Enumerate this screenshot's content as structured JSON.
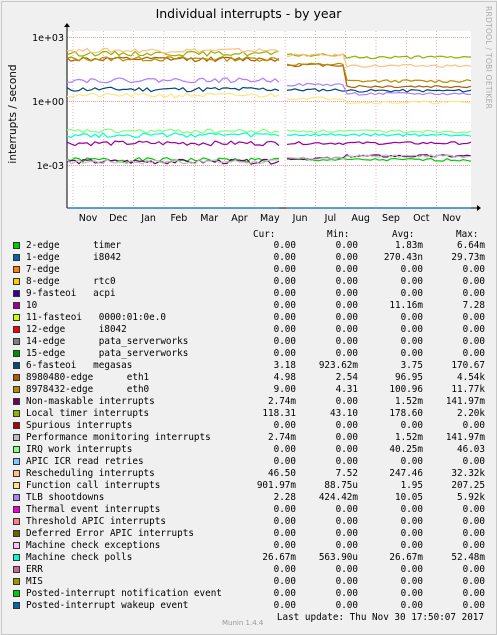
{
  "title": "Individual interrupts - by year",
  "side_text": "RRDTOOL / TOBI OETIKER",
  "munin_version": "Munin 1.4.4",
  "last_update": "Last update:  Thu Nov 30 17:50:07 2017",
  "legend_headers": {
    "cur": "Cur:",
    "min": "Min:",
    "avg": "Avg:",
    "max": "Max:"
  },
  "chart_data": {
    "type": "line",
    "title": "Individual interrupts - by year",
    "ylabel": "interrupts / second",
    "yscale": "log",
    "ylim": [
      1e-05,
      2000
    ],
    "y_ticks": [
      "1e+03",
      "1e+00",
      "1e-03"
    ],
    "x_ticks": [
      "Nov",
      "Dec",
      "Jan",
      "Feb",
      "Mar",
      "Apr",
      "May",
      "Jun",
      "Jul",
      "Aug",
      "Sep",
      "Oct",
      "Nov"
    ],
    "grid": true,
    "series": [
      {
        "name": "2-edge      timer",
        "color": "#00cc00",
        "cur": "0.00",
        "min": "0.00",
        "avg": "1.83m",
        "max": "6.64m"
      },
      {
        "name": "1-edge      i8042",
        "color": "#0066b3",
        "cur": "0.00",
        "min": "0.00",
        "avg": "270.43n",
        "max": "29.73m"
      },
      {
        "name": "7-edge",
        "color": "#ff8000",
        "cur": "0.00",
        "min": "0.00",
        "avg": "0.00",
        "max": "0.00"
      },
      {
        "name": "8-edge      rtc0",
        "color": "#ffcc00",
        "cur": "0.00",
        "min": "0.00",
        "avg": "0.00",
        "max": "0.00"
      },
      {
        "name": "9-fasteoi   acpi",
        "color": "#330099",
        "cur": "0.00",
        "min": "0.00",
        "avg": "0.00",
        "max": "0.00"
      },
      {
        "name": "10",
        "color": "#990099",
        "cur": "0.00",
        "min": "0.00",
        "avg": "11.16m",
        "max": "7.28"
      },
      {
        "name": "11-fasteoi   0000:01:0e.0",
        "color": "#ccff00",
        "cur": "0.00",
        "min": "0.00",
        "avg": "0.00",
        "max": "0.00"
      },
      {
        "name": "12-edge      i8042",
        "color": "#ff0000",
        "cur": "0.00",
        "min": "0.00",
        "avg": "0.00",
        "max": "0.00"
      },
      {
        "name": "14-edge      pata_serverworks",
        "color": "#808080",
        "cur": "0.00",
        "min": "0.00",
        "avg": "0.00",
        "max": "0.00"
      },
      {
        "name": "15-edge      pata_serverworks",
        "color": "#008f00",
        "cur": "0.00",
        "min": "0.00",
        "avg": "0.00",
        "max": "0.00"
      },
      {
        "name": "6-fasteoi   megasas",
        "color": "#00487d",
        "cur": "3.18",
        "min": "923.62m",
        "avg": "3.75",
        "max": "170.67"
      },
      {
        "name": "8980480-edge      eth1",
        "color": "#b35a00",
        "cur": "4.98",
        "min": "2.54",
        "avg": "96.95",
        "max": "4.54k"
      },
      {
        "name": "8978432-edge      eth0",
        "color": "#b38f00",
        "cur": "9.00",
        "min": "4.31",
        "avg": "100.96",
        "max": "11.77k"
      },
      {
        "name": "Non-maskable interrupts",
        "color": "#6b006b",
        "cur": "2.74m",
        "min": "0.00",
        "avg": "1.52m",
        "max": "141.97m"
      },
      {
        "name": "Local timer interrupts",
        "color": "#8fb300",
        "cur": "118.31",
        "min": "43.10",
        "avg": "178.60",
        "max": "2.20k"
      },
      {
        "name": "Spurious interrupts",
        "color": "#b30000",
        "cur": "0.00",
        "min": "0.00",
        "avg": "0.00",
        "max": "0.00"
      },
      {
        "name": "Performance monitoring interrupts",
        "color": "#bebebe",
        "cur": "2.74m",
        "min": "0.00",
        "avg": "1.52m",
        "max": "141.97m"
      },
      {
        "name": "IRQ work interrupts",
        "color": "#80ff80",
        "cur": "0.00",
        "min": "0.00",
        "avg": "40.25m",
        "max": "46.03"
      },
      {
        "name": "APIC ICR read retries",
        "color": "#80c9ff",
        "cur": "0.00",
        "min": "0.00",
        "avg": "0.00",
        "max": "0.00"
      },
      {
        "name": "Rescheduling interrupts",
        "color": "#ffc080",
        "cur": "46.50",
        "min": "7.52",
        "avg": "247.46",
        "max": "32.32k"
      },
      {
        "name": "Function call interrupts",
        "color": "#ffe680",
        "cur": "901.97m",
        "min": "88.75u",
        "avg": "1.95",
        "max": "207.25"
      },
      {
        "name": "TLB shootdowns",
        "color": "#aa80ff",
        "cur": "2.28",
        "min": "424.42m",
        "avg": "10.05",
        "max": "5.92k"
      },
      {
        "name": "Thermal event interrupts",
        "color": "#ee00cc",
        "cur": "0.00",
        "min": "0.00",
        "avg": "0.00",
        "max": "0.00"
      },
      {
        "name": "Threshold APIC interrupts",
        "color": "#ff8080",
        "cur": "0.00",
        "min": "0.00",
        "avg": "0.00",
        "max": "0.00"
      },
      {
        "name": "Deferred Error APIC interrupts",
        "color": "#666600",
        "cur": "0.00",
        "min": "0.00",
        "avg": "0.00",
        "max": "0.00"
      },
      {
        "name": "Machine check exceptions",
        "color": "#ffbfff",
        "cur": "0.00",
        "min": "0.00",
        "avg": "0.00",
        "max": "0.00"
      },
      {
        "name": "Machine check polls",
        "color": "#00ffcc",
        "cur": "26.67m",
        "min": "563.90u",
        "avg": "26.67m",
        "max": "52.48m"
      },
      {
        "name": "ERR",
        "color": "#cc6699",
        "cur": "0.00",
        "min": "0.00",
        "avg": "0.00",
        "max": "0.00"
      },
      {
        "name": "MIS",
        "color": "#999900",
        "cur": "0.00",
        "min": "0.00",
        "avg": "0.00",
        "max": "0.00"
      },
      {
        "name": "Posted-interrupt notification event",
        "color": "#00cc00",
        "cur": "0.00",
        "min": "0.00",
        "avg": "0.00",
        "max": "0.00"
      },
      {
        "name": "Posted-interrupt wakeup event",
        "color": "#0066b3",
        "cur": "0.00",
        "min": "0.00",
        "avg": "0.00",
        "max": "0.00"
      }
    ]
  }
}
